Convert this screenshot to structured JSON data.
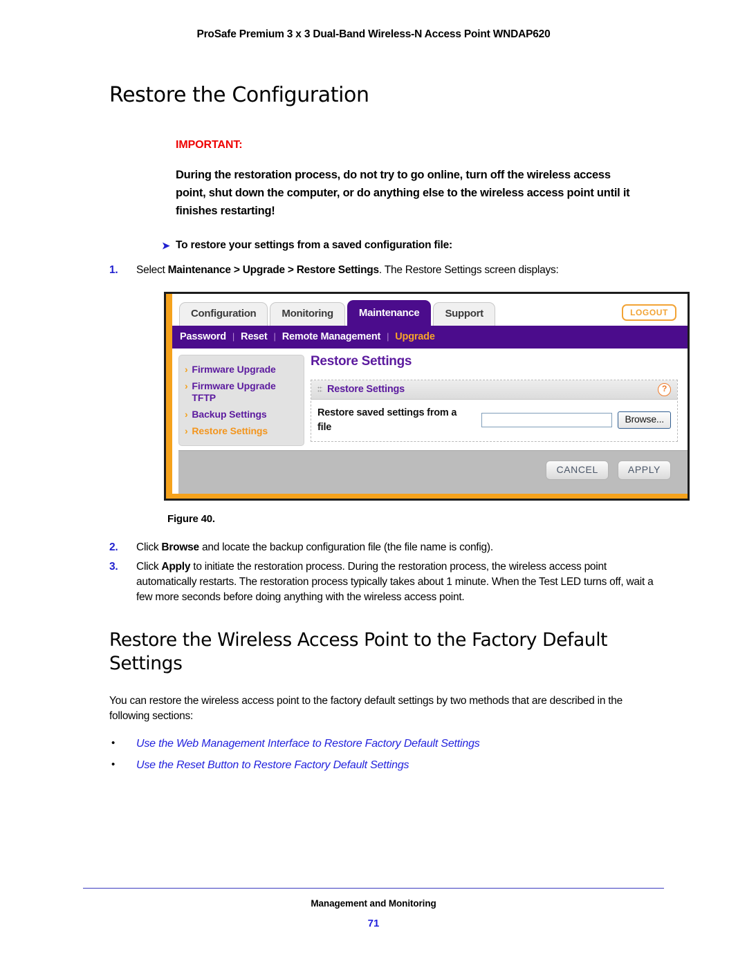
{
  "running_header": "ProSafe Premium 3 x 3 Dual-Band Wireless-N Access Point WNDAP620",
  "chapter_title": "Restore the Configuration",
  "important": {
    "label": "IMPORTANT:",
    "text": "During the restoration process, do not try to go online, turn off the wireless access point, shut down the computer, or do anything else to the wireless access point until it finishes restarting!"
  },
  "procedure": {
    "marker": "➤",
    "heading": "To restore your settings from a saved configuration file:",
    "steps": [
      {
        "num": "1.",
        "pre": "Select ",
        "bold": "Maintenance > Upgrade > Restore Settings",
        "post": ". The Restore Settings screen displays:"
      },
      {
        "num": "2.",
        "pre": "Click ",
        "bold": "Browse",
        "post": " and locate the backup configuration file (the file name is config)."
      },
      {
        "num": "3.",
        "pre": "Click ",
        "bold": "Apply",
        "post": " to initiate the restoration process. During the restoration process, the wireless access point automatically restarts. The restoration process typically takes about 1 minute. When the Test LED turns off, wait a few more seconds before doing anything with the wireless access point."
      }
    ]
  },
  "figure": {
    "caption": "Figure 40.",
    "tabs": [
      {
        "label": "Configuration",
        "active": false
      },
      {
        "label": "Monitoring",
        "active": false
      },
      {
        "label": "Maintenance",
        "active": true
      },
      {
        "label": "Support",
        "active": false
      }
    ],
    "logout_label": "LOGOUT",
    "subnav": [
      {
        "label": "Password",
        "active": false
      },
      {
        "label": "Reset",
        "active": false
      },
      {
        "label": "Remote Management",
        "active": false
      },
      {
        "label": "Upgrade",
        "active": true
      }
    ],
    "subnav_separator": "|",
    "sidebar": [
      {
        "label": "Firmware Upgrade",
        "chevron": "›",
        "active": false
      },
      {
        "label": "Firmware Upgrade TFTP",
        "chevron": "›",
        "active": false
      },
      {
        "label": "Backup Settings",
        "chevron": "›",
        "active": false
      },
      {
        "label": "Restore Settings",
        "chevron": "›",
        "active": true
      }
    ],
    "pane_title": "Restore Settings",
    "panel_title": "Restore Settings",
    "help_glyph": "?",
    "row_label": "Restore saved settings from a file",
    "file_value": "",
    "file_placeholder": "",
    "browse_label": "Browse...",
    "cancel_label": "CANCEL",
    "apply_label": "APPLY",
    "colors": {
      "purple": "#4b0c8c",
      "orange": "#f2a01c",
      "link_purple": "#5b1a9e"
    }
  },
  "section2": {
    "title": "Restore the Wireless Access Point to the Factory Default Settings",
    "body": "You can restore the wireless access point to the factory default settings by two methods that are described in the following sections:",
    "links": [
      "Use the Web Management Interface to Restore Factory Default Settings",
      "Use the Reset Button to Restore Factory Default Settings"
    ],
    "bullet": "•"
  },
  "footer": {
    "title": "Management and Monitoring",
    "page_number": "71"
  }
}
